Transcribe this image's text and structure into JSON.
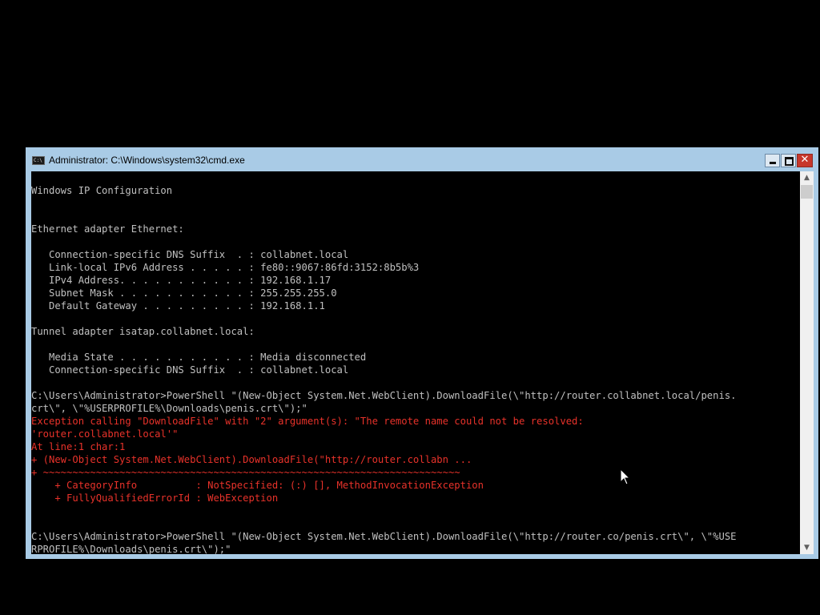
{
  "window": {
    "title": "Administrator: C:\\Windows\\system32\\cmd.exe",
    "app_icon": "cmd-icon",
    "app_icon_text": "C:\\",
    "controls": {
      "minimize_icon": "minimize-icon",
      "maximize_icon": "maximize-icon",
      "close_glyph": "✕"
    }
  },
  "colors": {
    "titlebar": "#a9cbe6",
    "console_bg": "#000000",
    "console_text": "#c0c0c0",
    "error_text": "#e8322a",
    "close_button": "#c7372b"
  },
  "scrollbar": {
    "up_glyph": "▲",
    "down_glyph": "▼"
  },
  "console": {
    "lines": [
      "",
      "Windows IP Configuration",
      "",
      "",
      "Ethernet adapter Ethernet:",
      "",
      "   Connection-specific DNS Suffix  . : collabnet.local",
      "   Link-local IPv6 Address . . . . . : fe80::9067:86fd:3152:8b5b%3",
      "   IPv4 Address. . . . . . . . . . . : 192.168.1.17",
      "   Subnet Mask . . . . . . . . . . . : 255.255.255.0",
      "   Default Gateway . . . . . . . . . : 192.168.1.1",
      "",
      "Tunnel adapter isatap.collabnet.local:",
      "",
      "   Media State . . . . . . . . . . . : Media disconnected",
      "   Connection-specific DNS Suffix  . : collabnet.local",
      "",
      "C:\\Users\\Administrator>PowerShell \"(New-Object System.Net.WebClient).DownloadFile(\\\"http://router.collabnet.local/penis.",
      "crt\\\", \\\"%USERPROFILE%\\Downloads\\penis.crt\\\");\"",
      "Exception calling \"DownloadFile\" with \"2\" argument(s): \"The remote name could not be resolved:",
      "'router.collabnet.local'\"",
      "At line:1 char:1",
      "+ (New-Object System.Net.WebClient).DownloadFile(\"http://router.collabn ...",
      "+ ~~~~~~~~~~~~~~~~~~~~~~~~~~~~~~~~~~~~~~~~~~~~~~~~~~~~~~~~~~~~~~~~~~~~~~~",
      "    + CategoryInfo          : NotSpecified: (:) [], MethodInvocationException",
      "    + FullyQualifiedErrorId : WebException",
      "",
      "",
      "C:\\Users\\Administrator>PowerShell \"(New-Object System.Net.WebClient).DownloadFile(\\\"http://router.co/penis.crt\\\", \\\"%USE",
      "RPROFILE%\\Downloads\\penis.crt\\\");\""
    ],
    "error_line_indices": [
      19,
      20,
      21,
      22,
      23,
      24,
      25
    ]
  }
}
